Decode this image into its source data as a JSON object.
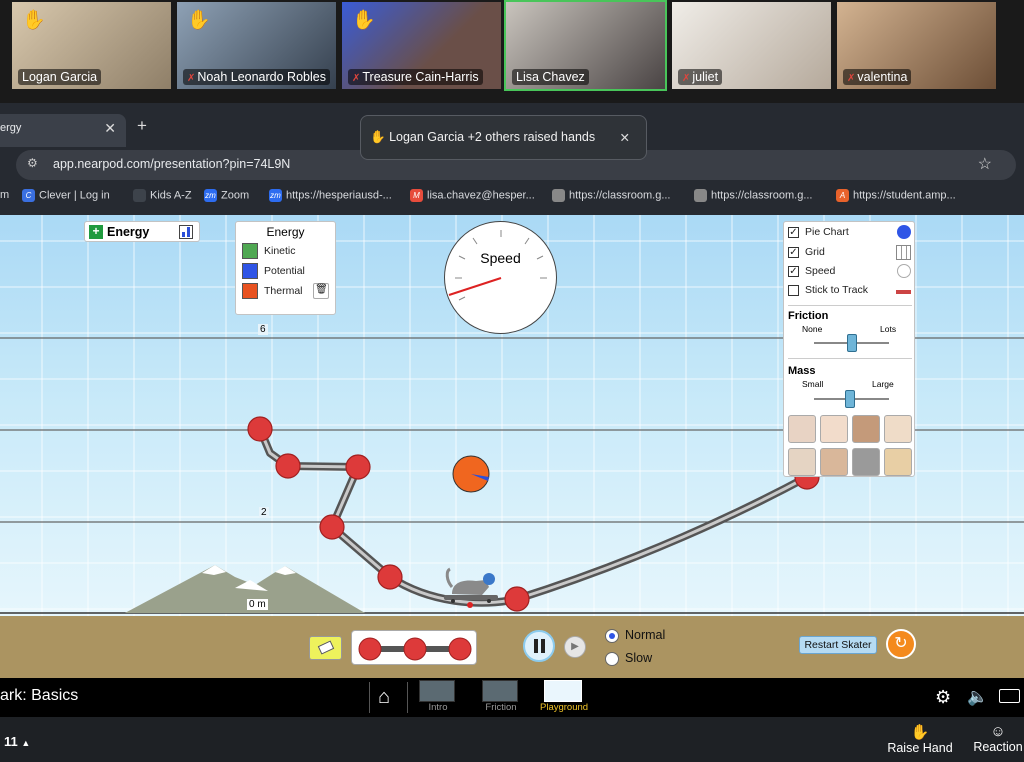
{
  "participants": [
    {
      "name": "Logan Garcia",
      "muted": false,
      "hand": true,
      "color": "#b9a78f"
    },
    {
      "name": "Noah Leonardo Robles",
      "muted": true,
      "hand": true,
      "color": "#6f7f95"
    },
    {
      "name": "Treasure Cain-Harris",
      "muted": true,
      "hand": true,
      "color": "#6b5a53"
    },
    {
      "name": "Lisa Chavez",
      "muted": false,
      "hand": false,
      "color": "#8b8686"
    },
    {
      "name": "juliet",
      "muted": true,
      "hand": false,
      "color": "#d2cfc9"
    },
    {
      "name": "valentina",
      "muted": true,
      "hand": false,
      "color": "#a8876a"
    }
  ],
  "browser": {
    "tab_title": "ergy",
    "url": "app.nearpod.com/presentation?pin=74L9N",
    "toast": "Logan Garcia +2 others raised hands",
    "bookmarks": [
      "m",
      "Clever | Log in",
      "Kids A-Z",
      "Zoom",
      "https://hesperiausd-...",
      "lisa.chavez@hesper...",
      "https://classroom.g...",
      "https://classroom.g...",
      "https://student.amp..."
    ]
  },
  "sim": {
    "energy_button": "Energy",
    "legend": {
      "title": "Energy",
      "kinetic": "Kinetic",
      "potential": "Potential",
      "thermal": "Thermal"
    },
    "speedometer": "Speed",
    "height_labels": {
      "six": "6",
      "two": "2",
      "zero": "0 m"
    },
    "controls": {
      "pie_chart": "Pie Chart",
      "grid": "Grid",
      "speed": "Speed",
      "stick": "Stick to Track",
      "friction": "Friction",
      "none": "None",
      "lots": "Lots",
      "mass": "Mass",
      "small": "Small",
      "large": "Large"
    },
    "playback": {
      "normal": "Normal",
      "slow": "Slow",
      "restart": "Restart Skater"
    }
  },
  "nav": {
    "title": "ark: Basics",
    "screens": [
      "Intro",
      "Friction",
      "Playground"
    ]
  },
  "zoom": {
    "count": "11",
    "raise_hand": "Raise Hand",
    "reactions": "Reaction"
  }
}
